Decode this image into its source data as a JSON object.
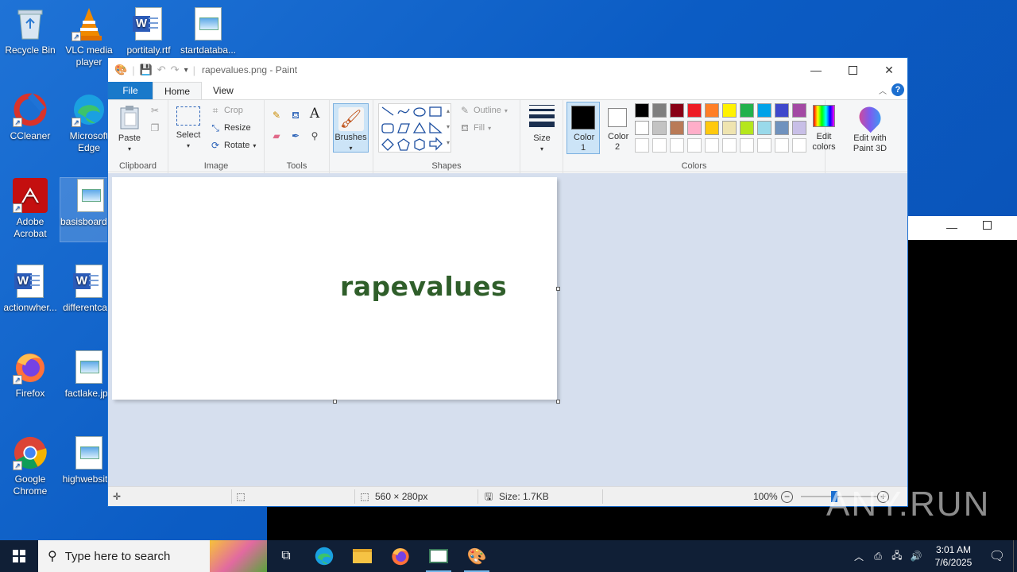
{
  "desktop": {
    "icons": [
      {
        "label": "Recycle Bin"
      },
      {
        "label": "VLC media player"
      },
      {
        "label": "portitaly.rtf"
      },
      {
        "label": "startdataba..."
      },
      {
        "label": "CCleaner"
      },
      {
        "label": "Microsoft Edge"
      },
      {
        "label": "Adobe Acrobat"
      },
      {
        "label": "basisboard.jpg"
      },
      {
        "label": "actionwher..."
      },
      {
        "label": "differentca..."
      },
      {
        "label": "Firefox"
      },
      {
        "label": "factlake.jpg"
      },
      {
        "label": "Google Chrome"
      },
      {
        "label": "highwebsit..."
      }
    ]
  },
  "paint": {
    "title": "rapevalues.png - Paint",
    "tabs": {
      "file": "File",
      "home": "Home",
      "view": "View"
    },
    "clipboard": {
      "paste": "Paste",
      "label": "Clipboard"
    },
    "image": {
      "select": "Select",
      "crop": "Crop",
      "resize": "Resize",
      "rotate": "Rotate",
      "label": "Image"
    },
    "tools": {
      "label": "Tools"
    },
    "brushes": "Brushes",
    "shapes": {
      "outline": "Outline",
      "fill": "Fill",
      "label": "Shapes"
    },
    "size": "Size",
    "colors": {
      "color1": "Color 1",
      "color2": "Color 2",
      "edit": "Edit colors",
      "label": "Colors",
      "color1_value": "#000000",
      "color2_value": "#ffffff",
      "palette_row1": [
        "#000000",
        "#7f7f7f",
        "#880015",
        "#ed1c24",
        "#ff7f27",
        "#fff200",
        "#22b14c",
        "#00a2e8",
        "#3f48cc",
        "#a349a4"
      ],
      "palette_row2": [
        "#ffffff",
        "#c3c3c3",
        "#b97a57",
        "#ffaec9",
        "#ffc90e",
        "#efe4b0",
        "#b5e61d",
        "#99d9ea",
        "#7092be",
        "#c8bfe7"
      ]
    },
    "paint3d": "Edit with Paint 3D",
    "canvas_text": "rapevalues",
    "status": {
      "dimensions": "560 × 280px",
      "size": "Size: 1.7KB",
      "zoom": "100%"
    }
  },
  "taskbar": {
    "search_placeholder": "Type here to search",
    "time": "3:01 AM",
    "date": "7/6/2025"
  },
  "watermark": "ANY.RUN"
}
